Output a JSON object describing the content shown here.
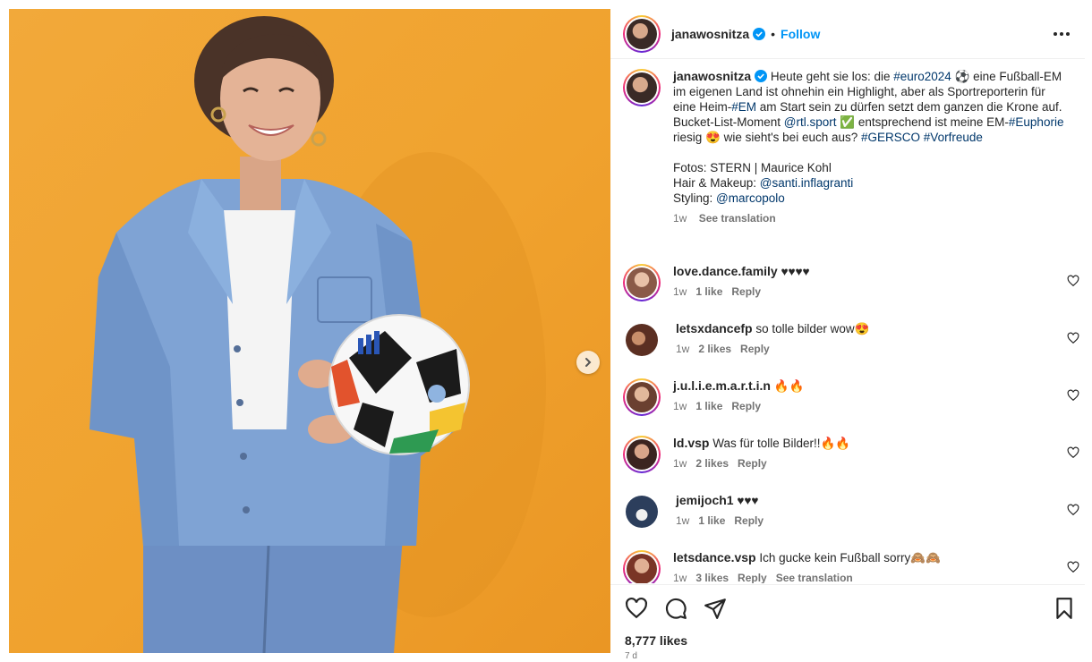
{
  "post": {
    "username": "janawosnitza",
    "follow_label": "Follow",
    "dot": "•"
  },
  "caption": {
    "username": "janawosnitza",
    "line1_a": "Heute geht sie los: die ",
    "tag_euro": "#euro2024",
    "line1_b": " ⚽ eine Fußball-EM im eigenen Land ist ohnehin ein Highlight, aber als Sportreporterin für eine Heim-",
    "tag_em": "#EM",
    "line1_c": " am Start sein zu dürfen setzt dem ganzen die Krone auf. Bucket-List-Moment ",
    "mention_rtl": "@rtl.sport",
    "line1_d": " ✅ entsprechend ist meine EM-",
    "tag_euphorie": "#Euphorie",
    "line1_e": " riesig 😍 wie sieht's bei euch aus? ",
    "tag_gersco": "#GERSCO",
    "tag_vorfreude": "#Vorfreude",
    "credits_fotos": "Fotos: STERN | Maurice Kohl",
    "credits_hair_label": "Hair & Makeup: ",
    "mention_santi": "@santi.inflagranti",
    "credits_styling_label": "Styling: ",
    "mention_marco": "@marcopolo",
    "time": "1w",
    "see_translation": "See translation"
  },
  "comments": [
    {
      "username": "love.dance.family",
      "text": "♥♥♥♥",
      "time": "1w",
      "likes": "1 like",
      "reply": "Reply"
    },
    {
      "username": "letsxdancefp",
      "text": "so tolle bilder wow😍",
      "time": "1w",
      "likes": "2 likes",
      "reply": "Reply"
    },
    {
      "username": "j.u.l.i.e.m.a.r.t.i.n",
      "text": "🔥🔥",
      "time": "1w",
      "likes": "1 like",
      "reply": "Reply"
    },
    {
      "username": "ld.vsp",
      "text": "Was für tolle Bilder!!🔥🔥",
      "time": "1w",
      "likes": "2 likes",
      "reply": "Reply"
    },
    {
      "username": "jemijoch1",
      "text": "♥♥♥",
      "time": "1w",
      "likes": "1 like",
      "reply": "Reply"
    },
    {
      "username": "letsdance.vsp",
      "text": "Ich gucke kein Fußball sorry🙈🙈",
      "time": "1w",
      "likes": "3 likes",
      "reply": "Reply",
      "see_translation": "See translation"
    }
  ],
  "actions": {
    "likes": "8,777 likes",
    "time": "7 d"
  },
  "colors": {
    "accent": "#0095f6",
    "tag": "#00376b",
    "muted": "#737373",
    "photo_bg": "#f0a22e"
  },
  "icons": [
    "verified-icon",
    "more-options-icon",
    "heart-icon",
    "comment-icon",
    "share-icon",
    "bookmark-icon",
    "chevron-right-icon"
  ]
}
